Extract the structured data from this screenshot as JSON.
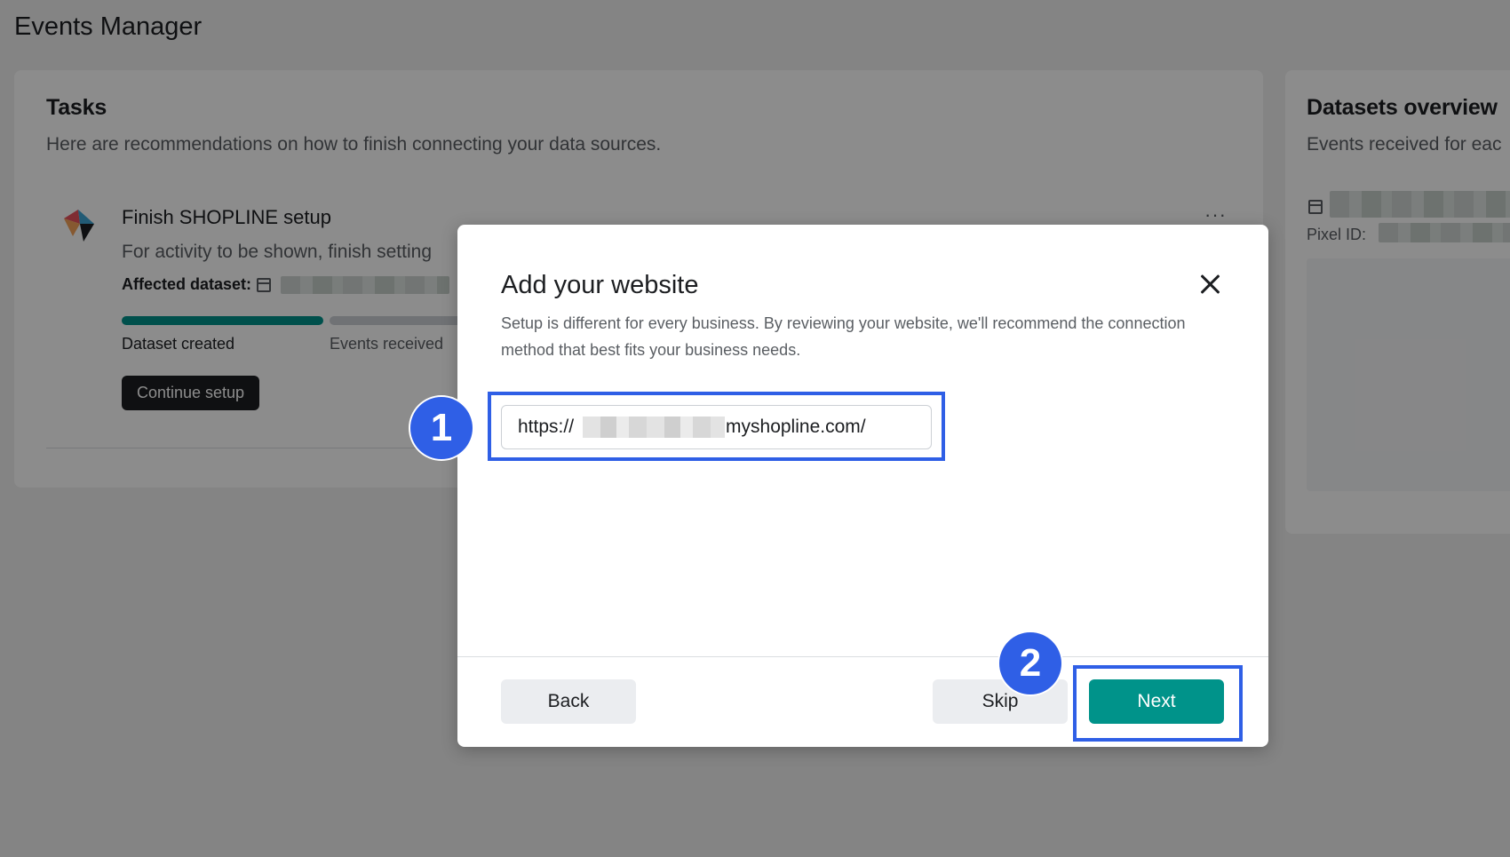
{
  "page": {
    "title": "Events Manager"
  },
  "tasks": {
    "heading": "Tasks",
    "subtitle": "Here are recommendations on how to finish connecting your data sources.",
    "item": {
      "title": "Finish SHOPLINE setup",
      "description": "For activity to be shown, finish setting",
      "affected_label": "Affected dataset:",
      "steps": [
        {
          "label": "Dataset created",
          "status": "complete"
        },
        {
          "label": "Events received",
          "status": "pending"
        }
      ],
      "continue_label": "Continue setup",
      "more_label": "···"
    }
  },
  "datasets": {
    "heading": "Datasets overview",
    "subtitle": "Events received for eac",
    "pixel_id_label": "Pixel ID:"
  },
  "modal": {
    "title": "Add your website",
    "description": "Setup is different for every business. By reviewing your website, we'll recommend the connection method that best fits your business needs.",
    "url_prefix": "https://",
    "url_suffix": "myshopline.com/",
    "back_label": "Back",
    "skip_label": "Skip",
    "next_label": "Next"
  },
  "annotations": {
    "step1": "1",
    "step2": "2"
  },
  "colors": {
    "accent": "#00938a",
    "highlight": "#2f5fe6",
    "progress_done": "#00938a",
    "progress_pending": "#ccd0d5"
  }
}
